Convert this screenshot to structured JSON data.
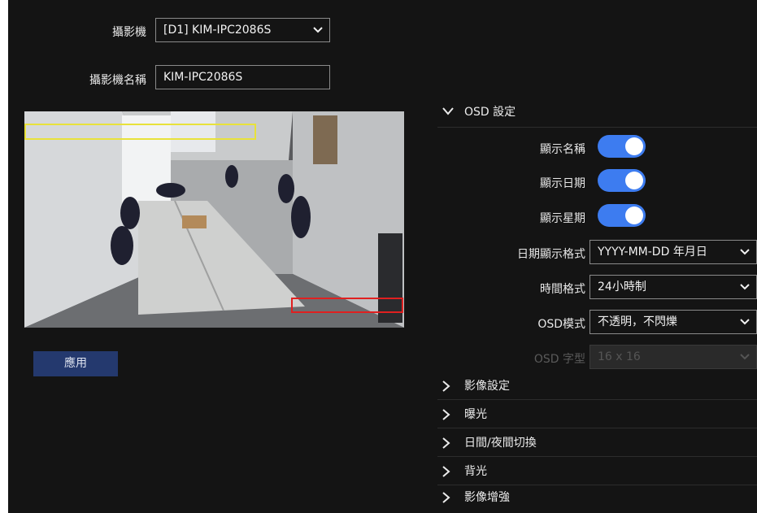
{
  "camera": {
    "label": "攝影機",
    "selected": "[D1] KIM-IPC2086S"
  },
  "camera_name": {
    "label": "攝影機名稱",
    "value": "KIM-IPC2086S"
  },
  "apply_label": "應用",
  "osd_settings": {
    "title": "OSD 設定",
    "show_name": {
      "label": "顯示名稱",
      "on": true
    },
    "show_date": {
      "label": "顯示日期",
      "on": true
    },
    "show_week": {
      "label": "顯示星期",
      "on": true
    },
    "date_format": {
      "label": "日期顯示格式",
      "value": "YYYY-MM-DD 年月日"
    },
    "time_format": {
      "label": "時間格式",
      "value": "24小時制"
    },
    "osd_mode": {
      "label": "OSD模式",
      "value": "不透明，不閃爍"
    },
    "osd_font": {
      "label": "OSD 字型",
      "value": "16 x 16"
    }
  },
  "sections": [
    {
      "label": "影像設定"
    },
    {
      "label": "曝光"
    },
    {
      "label": "日間/夜間切換"
    },
    {
      "label": "背光"
    },
    {
      "label": "影像增強"
    }
  ],
  "colors": {
    "background": "#141414",
    "toggle_on": "#3d7cf0",
    "apply_button": "#24396e",
    "osd_name_box": "#e8e23a",
    "osd_date_box": "#e02020"
  },
  "icons": {
    "dropdown": "chevron-down-icon",
    "expanded": "chevron-down-icon",
    "collapsed": "chevron-right-icon"
  }
}
